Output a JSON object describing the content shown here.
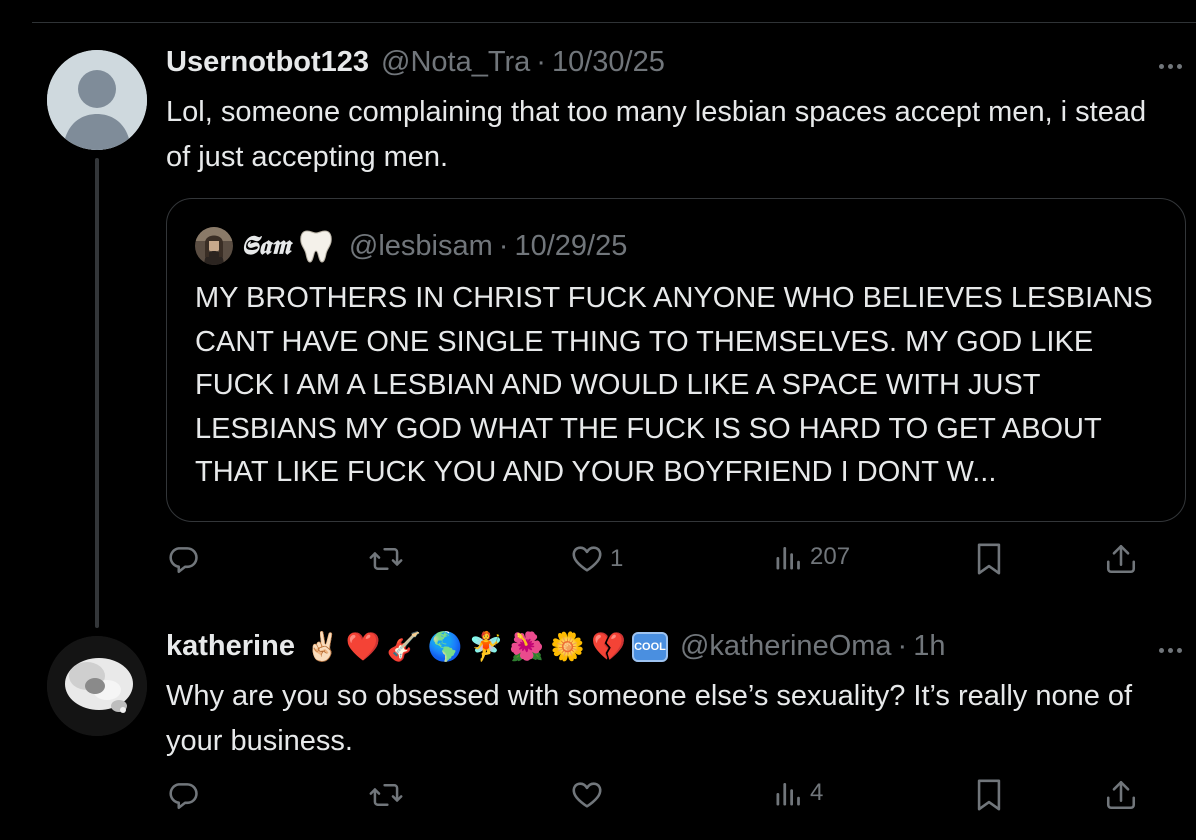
{
  "reply_1": {
    "display_name": "Usernotbot123",
    "handle": "@Nota_Tra",
    "separator": "·",
    "date": "10/30/25",
    "text": "Lol, someone complaining that too many lesbian spaces accept men, i stead of just accepting men.",
    "avatar_icon": "default-profile-silhouette",
    "quoted": {
      "display_name": "𝕾𝖆𝖒",
      "emoji": "tooth-icon",
      "handle": "@lesbisam",
      "separator": "·",
      "date": "10/29/25",
      "text": "MY BROTHERS IN CHRIST FUCK ANYONE WHO BELIEVES LESBIANS CANT HAVE ONE SINGLE THING TO THEMSELVES. MY GOD LIKE FUCK I AM A LESBIAN AND WOULD LIKE A SPACE WITH JUST LESBIANS MY GOD WHAT THE FUCK IS SO HARD TO GET ABOUT THAT LIKE FUCK YOU AND YOUR BOYFRIEND I DONT W..."
    },
    "actions": {
      "reply_count": "",
      "repost_count": "",
      "like_count": "1",
      "views_count": "207"
    }
  },
  "reply_2": {
    "display_name": "katherine",
    "emojis": [
      "✌🏻",
      "❤️",
      "🎸",
      "🌎",
      "🧚",
      "🌺",
      "🌼",
      "💔"
    ],
    "cool_badge": "COOL",
    "handle": "@katherineOma",
    "separator": "·",
    "time": "1h",
    "text": "Why are you so obsessed with someone else’s sexuality? It’s really none of your business.",
    "actions": {
      "reply_count": "",
      "repost_count": "",
      "like_count": "",
      "views_count": "4"
    }
  },
  "colors": {
    "background": "#000000",
    "text": "#e7e9ea",
    "muted": "#71767b",
    "border": "#333639"
  }
}
